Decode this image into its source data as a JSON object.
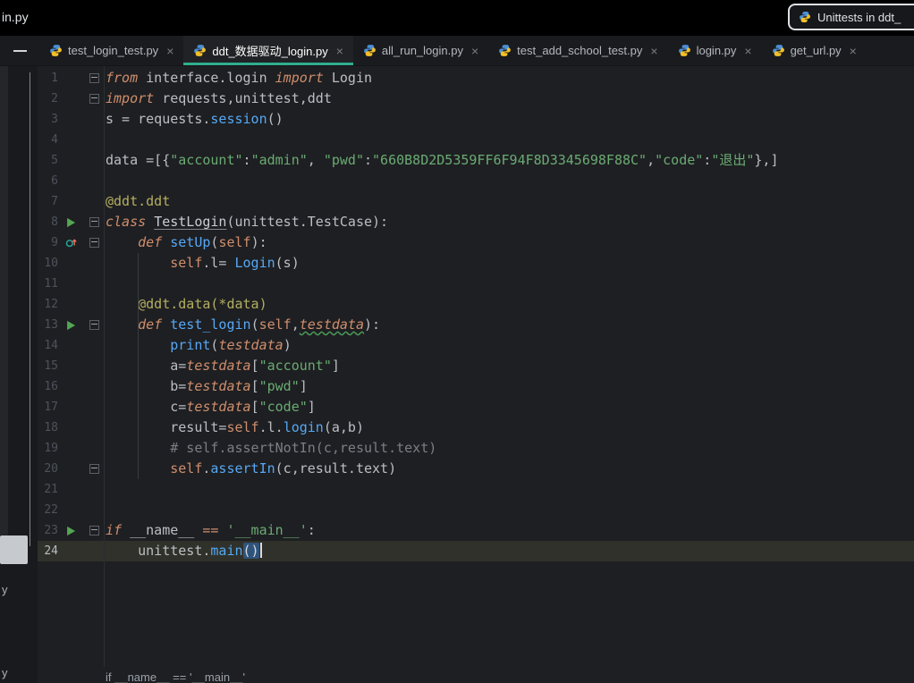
{
  "titlebar": {
    "partial_title": "in.py",
    "run_config_label": "Unittests in ddt_"
  },
  "tabbar": {
    "tabs": [
      {
        "label": "test_login_test.py",
        "close": "×",
        "active": false
      },
      {
        "label": "ddt_数据驱动_login.py",
        "close": "×",
        "active": true
      },
      {
        "label": "all_run_login.py",
        "close": "×",
        "active": false
      },
      {
        "label": "test_add_school_test.py",
        "close": "×",
        "active": false
      },
      {
        "label": "login.py",
        "close": "×",
        "active": false
      },
      {
        "label": "get_url.py",
        "close": "×",
        "active": false
      }
    ]
  },
  "left_stripe": {
    "partial_labels": [
      "y",
      "y"
    ]
  },
  "editor": {
    "lines": [
      {
        "n": 1,
        "fold": true,
        "tokens": [
          {
            "t": "from",
            "c": "kw"
          },
          {
            "t": " interface.login ",
            "c": "plain"
          },
          {
            "t": "import",
            "c": "kw"
          },
          {
            "t": " Login",
            "c": "plain"
          }
        ]
      },
      {
        "n": 2,
        "fold": true,
        "tokens": [
          {
            "t": "import",
            "c": "kw"
          },
          {
            "t": " requests,unittest,ddt",
            "c": "plain"
          }
        ]
      },
      {
        "n": 3,
        "tokens": [
          {
            "t": "s = requests.",
            "c": "plain"
          },
          {
            "t": "session",
            "c": "fn"
          },
          {
            "t": "()",
            "c": "plain"
          }
        ]
      },
      {
        "n": 4,
        "tokens": []
      },
      {
        "n": 5,
        "tokens": [
          {
            "t": "data =[{",
            "c": "plain"
          },
          {
            "t": "\"account\"",
            "c": "str"
          },
          {
            "t": ":",
            "c": "plain"
          },
          {
            "t": "\"admin\"",
            "c": "str"
          },
          {
            "t": ", ",
            "c": "plain"
          },
          {
            "t": "\"pwd\"",
            "c": "str"
          },
          {
            "t": ":",
            "c": "plain"
          },
          {
            "t": "\"660B8D2D5359FF6F94F8D3345698F88C\"",
            "c": "str"
          },
          {
            "t": ",",
            "c": "plain"
          },
          {
            "t": "\"code\"",
            "c": "str"
          },
          {
            "t": ":",
            "c": "plain"
          },
          {
            "t": "\"退出\"",
            "c": "str"
          },
          {
            "t": "},]",
            "c": "plain"
          }
        ]
      },
      {
        "n": 6,
        "tokens": []
      },
      {
        "n": 7,
        "tokens": [
          {
            "t": "@ddt.ddt",
            "c": "dec"
          }
        ]
      },
      {
        "n": 8,
        "fold": true,
        "run": "run",
        "tokens": [
          {
            "t": "class",
            "c": "kw"
          },
          {
            "t": " ",
            "c": "plain"
          },
          {
            "t": "TestLogin",
            "c": "cls"
          },
          {
            "t": "(unittest.TestCase):",
            "c": "plain"
          }
        ]
      },
      {
        "n": 9,
        "fold": true,
        "run": "override",
        "tokens": [
          {
            "t": "    ",
            "c": "plain"
          },
          {
            "t": "def",
            "c": "kw"
          },
          {
            "t": " ",
            "c": "plain"
          },
          {
            "t": "setUp",
            "c": "fn"
          },
          {
            "t": "(",
            "c": "plain"
          },
          {
            "t": "self",
            "c": "self"
          },
          {
            "t": "):",
            "c": "plain"
          }
        ]
      },
      {
        "n": 10,
        "tokens": [
          {
            "t": "        ",
            "c": "plain"
          },
          {
            "t": "self",
            "c": "self"
          },
          {
            "t": ".l= ",
            "c": "plain"
          },
          {
            "t": "Login",
            "c": "fn"
          },
          {
            "t": "(s)",
            "c": "plain"
          }
        ]
      },
      {
        "n": 11,
        "tokens": []
      },
      {
        "n": 12,
        "tokens": [
          {
            "t": "    ",
            "c": "plain"
          },
          {
            "t": "@ddt.data(*data)",
            "c": "dec"
          }
        ]
      },
      {
        "n": 13,
        "fold": true,
        "run": "run",
        "tokens": [
          {
            "t": "    ",
            "c": "plain"
          },
          {
            "t": "def",
            "c": "kw"
          },
          {
            "t": " ",
            "c": "plain"
          },
          {
            "t": "test_login",
            "c": "fn"
          },
          {
            "t": "(",
            "c": "plain"
          },
          {
            "t": "self",
            "c": "self"
          },
          {
            "t": ",",
            "c": "plain"
          },
          {
            "t": "testdata",
            "c": "param typo"
          },
          {
            "t": "):",
            "c": "plain"
          }
        ]
      },
      {
        "n": 14,
        "tokens": [
          {
            "t": "        ",
            "c": "plain"
          },
          {
            "t": "print",
            "c": "fn"
          },
          {
            "t": "(",
            "c": "plain"
          },
          {
            "t": "testdata",
            "c": "param"
          },
          {
            "t": ")",
            "c": "plain"
          }
        ]
      },
      {
        "n": 15,
        "tokens": [
          {
            "t": "        a=",
            "c": "plain"
          },
          {
            "t": "testdata",
            "c": "param"
          },
          {
            "t": "[",
            "c": "plain"
          },
          {
            "t": "\"account\"",
            "c": "str"
          },
          {
            "t": "]",
            "c": "plain"
          }
        ]
      },
      {
        "n": 16,
        "tokens": [
          {
            "t": "        b=",
            "c": "plain"
          },
          {
            "t": "testdata",
            "c": "param"
          },
          {
            "t": "[",
            "c": "plain"
          },
          {
            "t": "\"pwd\"",
            "c": "str"
          },
          {
            "t": "]",
            "c": "plain"
          }
        ]
      },
      {
        "n": 17,
        "tokens": [
          {
            "t": "        c=",
            "c": "plain"
          },
          {
            "t": "testdata",
            "c": "param"
          },
          {
            "t": "[",
            "c": "plain"
          },
          {
            "t": "\"code\"",
            "c": "str"
          },
          {
            "t": "]",
            "c": "plain"
          }
        ]
      },
      {
        "n": 18,
        "tokens": [
          {
            "t": "        result=",
            "c": "plain"
          },
          {
            "t": "self",
            "c": "self"
          },
          {
            "t": ".l.",
            "c": "plain"
          },
          {
            "t": "login",
            "c": "fn"
          },
          {
            "t": "(a,b)",
            "c": "plain"
          }
        ]
      },
      {
        "n": 19,
        "tokens": [
          {
            "t": "        ",
            "c": "plain"
          },
          {
            "t": "# self.assertNotIn(c,result.text)",
            "c": "com"
          }
        ]
      },
      {
        "n": 20,
        "fold": true,
        "tokens": [
          {
            "t": "        ",
            "c": "plain"
          },
          {
            "t": "self",
            "c": "self"
          },
          {
            "t": ".",
            "c": "plain"
          },
          {
            "t": "assertIn",
            "c": "fn"
          },
          {
            "t": "(c,result.text)",
            "c": "plain"
          }
        ]
      },
      {
        "n": 21,
        "tokens": []
      },
      {
        "n": 22,
        "tokens": []
      },
      {
        "n": 23,
        "fold": true,
        "run": "run",
        "tokens": [
          {
            "t": "if",
            "c": "kw"
          },
          {
            "t": " __name__ ",
            "c": "plain"
          },
          {
            "t": "==",
            "c": "op"
          },
          {
            "t": " ",
            "c": "plain"
          },
          {
            "t": "'__main__'",
            "c": "str"
          },
          {
            "t": ":",
            "c": "plain"
          }
        ]
      },
      {
        "n": 24,
        "current": true,
        "caret": true,
        "tokens": [
          {
            "t": "    unittest.",
            "c": "plain"
          },
          {
            "t": "main",
            "c": "fn"
          },
          {
            "t": "()",
            "c": "brhl"
          }
        ]
      }
    ]
  },
  "breadcrumbs": {
    "text": "if __name__ == '__main__'"
  },
  "colors": {
    "editor_background": "#1e1f22",
    "active_tab_underline": "#2fae8c",
    "run_icon_green": "#53a653",
    "keyword_orange": "#cf8e6d",
    "string_green": "#6aab73",
    "function_blue": "#56a8f5",
    "decorator_yellow": "#b3ae60",
    "comment_gray": "#7a7e85",
    "brace_match_blue": "#2f547c"
  }
}
